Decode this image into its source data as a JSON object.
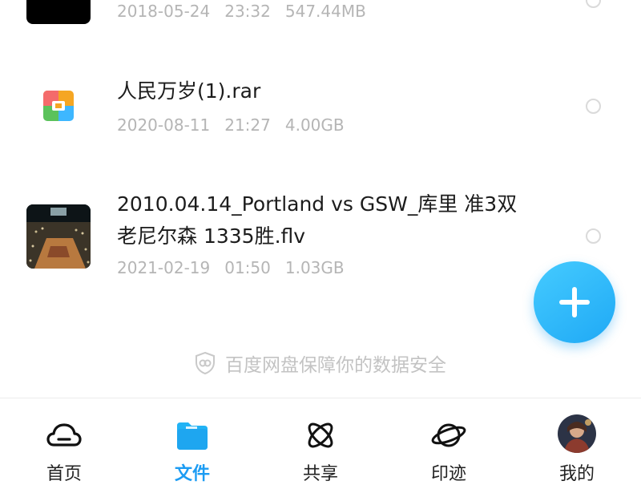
{
  "files": [
    {
      "name_lines": [],
      "date": "2018-05-24",
      "time": "23:32",
      "size": "547.44MB",
      "thumb_icon": "video-thumbnail-icon"
    },
    {
      "name_lines": [
        "人民万岁(1).rar"
      ],
      "date": "2020-08-11",
      "time": "21:27",
      "size": "4.00GB",
      "thumb_icon": "archive-rar-icon"
    },
    {
      "name_lines": [
        "2010.04.14_Portland vs GSW_库里 准3双",
        "老尼尔森 1335胜.flv"
      ],
      "date": "2021-02-19",
      "time": "01:50",
      "size": "1.03GB",
      "thumb_icon": "basketball-arena-thumbnail-icon"
    }
  ],
  "security_note": "百度网盘保障你的数据安全",
  "fab_icon": "plus-icon",
  "tabs": [
    {
      "label": "首页",
      "icon": "cloud-home-icon",
      "active": false
    },
    {
      "label": "文件",
      "icon": "folder-icon",
      "active": true
    },
    {
      "label": "共享",
      "icon": "atom-share-icon",
      "active": false
    },
    {
      "label": "印迹",
      "icon": "planet-icon",
      "active": false
    },
    {
      "label": "我的",
      "icon": "avatar-icon",
      "active": false
    }
  ],
  "colors": {
    "accent": "#1c9cf3",
    "meta_text": "#b5b5b5",
    "primary_text": "#1c1c1c"
  }
}
